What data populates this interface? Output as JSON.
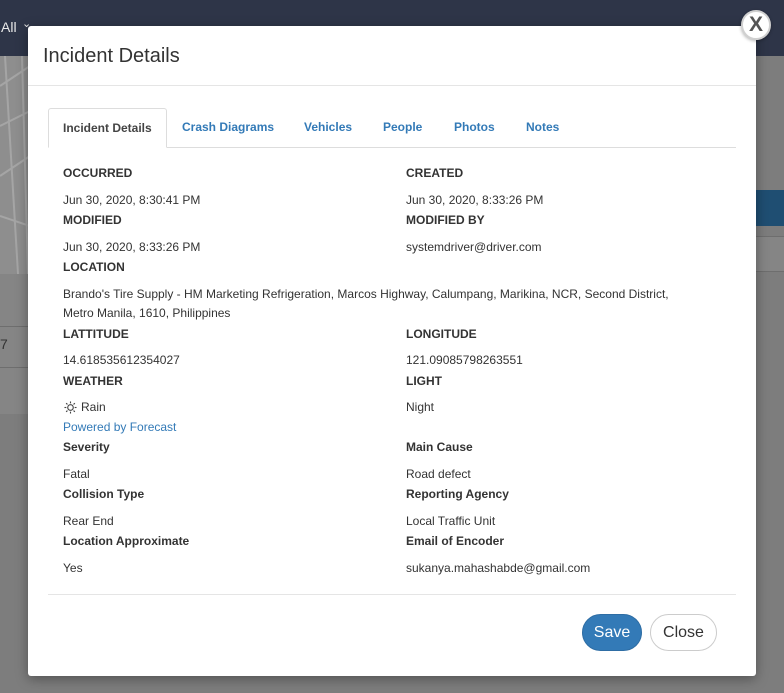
{
  "background": {
    "filter_label": "All",
    "number": "7"
  },
  "modal": {
    "title": "Incident Details",
    "close_label": "X",
    "tabs": [
      {
        "label": "Incident Details",
        "active": true
      },
      {
        "label": "Crash Diagrams"
      },
      {
        "label": "Vehicles"
      },
      {
        "label": "People"
      },
      {
        "label": "Photos"
      },
      {
        "label": "Notes"
      }
    ],
    "fields": {
      "occurred": {
        "label": "OCCURRED",
        "value": "Jun 30, 2020, 8:30:41 PM"
      },
      "created": {
        "label": "CREATED",
        "value": "Jun 30, 2020, 8:33:26 PM"
      },
      "modified": {
        "label": "MODIFIED",
        "value": "Jun 30, 2020, 8:33:26 PM"
      },
      "modified_by": {
        "label": "MODIFIED BY",
        "value": "systemdriver@driver.com"
      },
      "location": {
        "label": "LOCATION",
        "value_line1": "Brando's Tire Supply - HM Marketing Refrigeration, Marcos Highway, Calumpang, Marikina, NCR, Second District,",
        "value_line2": "Metro Manila, 1610, Philippines"
      },
      "latitude": {
        "label": "LATTITUDE",
        "value": "14.618535612354027"
      },
      "longitude": {
        "label": "LONGITUDE",
        "value": "121.09085798263551"
      },
      "weather": {
        "label": "WEATHER",
        "value": "Rain",
        "icon": "sun-icon",
        "link": "Powered by Forecast"
      },
      "light": {
        "label": "LIGHT",
        "value": "Night"
      },
      "severity": {
        "label": "Severity",
        "value": "Fatal"
      },
      "main_cause": {
        "label": "Main Cause",
        "value": "Road defect"
      },
      "collision_type": {
        "label": "Collision Type",
        "value": "Rear End"
      },
      "reporting_agency": {
        "label": "Reporting Agency",
        "value": "Local Traffic Unit"
      },
      "location_approximate": {
        "label": "Location Approximate",
        "value": "Yes"
      },
      "email_of_encoder": {
        "label": "Email of Encoder",
        "value": "sukanya.mahashabde@gmail.com"
      }
    },
    "buttons": {
      "save": "Save",
      "close": "Close"
    }
  },
  "colors": {
    "primary": "#337ab7",
    "topbar": "#2e3548"
  }
}
